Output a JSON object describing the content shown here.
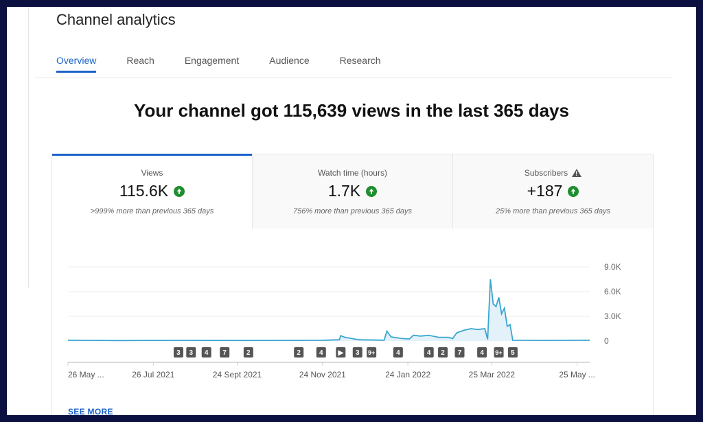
{
  "header": {
    "title": "Channel analytics"
  },
  "tabs": [
    {
      "label": "Overview",
      "active": true
    },
    {
      "label": "Reach"
    },
    {
      "label": "Engagement"
    },
    {
      "label": "Audience"
    },
    {
      "label": "Research"
    }
  ],
  "headline": "Your channel got 115,639 views in the last 365 days",
  "cards": [
    {
      "label": "Views",
      "value": "115.6K",
      "trend": "up",
      "comparison": ">999% more than previous 365 days"
    },
    {
      "label": "Watch time (hours)",
      "value": "1.7K",
      "trend": "up",
      "comparison": "756% more than previous 365 days"
    },
    {
      "label": "Subscribers",
      "value": "+187",
      "trend": "up",
      "warning": true,
      "comparison": "25% more than previous 365 days"
    }
  ],
  "see_more": "SEE MORE",
  "colors": {
    "accent": "#1a62c9",
    "line": "#3aa5cf",
    "fill": "#e3f2fa",
    "up": "#1e8e2e",
    "frame": "#0b1040"
  },
  "chart_data": {
    "type": "area",
    "xlim": [
      "2021-05-26",
      "2022-06-03"
    ],
    "ylim": [
      0,
      9000
    ],
    "y_ticks": [
      "9.0K",
      "6.0K",
      "3.0K",
      "0"
    ],
    "y_tick_values": [
      9000,
      6000,
      3000,
      0
    ],
    "x_tick_labels": [
      "26 May ...",
      "26 Jul 2021",
      "24 Sept 2021",
      "24 Nov 2021",
      "24 Jan 2022",
      "25 Mar 2022",
      "25 May ..."
    ],
    "x_tick_dates": [
      "2021-05-26",
      "2021-07-26",
      "2021-09-24",
      "2021-11-24",
      "2022-01-24",
      "2022-03-25",
      "2022-05-25"
    ],
    "grid": true,
    "points": [
      [
        "2021-05-26",
        100
      ],
      [
        "2021-06-10",
        80
      ],
      [
        "2021-07-01",
        60
      ],
      [
        "2021-08-15",
        80
      ],
      [
        "2021-10-01",
        70
      ],
      [
        "2021-11-25",
        100
      ],
      [
        "2021-12-06",
        150
      ],
      [
        "2021-12-07",
        650
      ],
      [
        "2021-12-10",
        450
      ],
      [
        "2021-12-15",
        300
      ],
      [
        "2021-12-20",
        150
      ],
      [
        "2022-01-07",
        100
      ],
      [
        "2022-01-09",
        1200
      ],
      [
        "2022-01-12",
        500
      ],
      [
        "2022-01-20",
        300
      ],
      [
        "2022-01-25",
        250
      ],
      [
        "2022-01-28",
        700
      ],
      [
        "2022-02-02",
        600
      ],
      [
        "2022-02-08",
        700
      ],
      [
        "2022-02-15",
        450
      ],
      [
        "2022-02-22",
        450
      ],
      [
        "2022-02-25",
        300
      ],
      [
        "2022-02-28",
        1000
      ],
      [
        "2022-03-05",
        1300
      ],
      [
        "2022-03-10",
        1500
      ],
      [
        "2022-03-15",
        1400
      ],
      [
        "2022-03-20",
        1500
      ],
      [
        "2022-03-22",
        200
      ],
      [
        "2022-03-24",
        7500
      ],
      [
        "2022-03-26",
        4500
      ],
      [
        "2022-03-28",
        4200
      ],
      [
        "2022-03-30",
        5300
      ],
      [
        "2022-04-01",
        3300
      ],
      [
        "2022-04-03",
        4000
      ],
      [
        "2022-04-05",
        1800
      ],
      [
        "2022-04-07",
        2000
      ],
      [
        "2022-04-09",
        100
      ],
      [
        "2022-05-01",
        80
      ],
      [
        "2022-06-03",
        100
      ]
    ],
    "markers": [
      [
        "2021-08-13",
        "3"
      ],
      [
        "2021-08-22",
        "3"
      ],
      [
        "2021-09-02",
        "4"
      ],
      [
        "2021-09-15",
        "7"
      ],
      [
        "2021-10-02",
        "2"
      ],
      [
        "2021-11-07",
        "2"
      ],
      [
        "2021-11-23",
        "4"
      ],
      [
        "2021-12-07",
        "▶"
      ],
      [
        "2021-12-19",
        "3"
      ],
      [
        "2021-12-29",
        "9+"
      ],
      [
        "2022-01-17",
        "4"
      ],
      [
        "2022-02-08",
        "4"
      ],
      [
        "2022-02-18",
        "2"
      ],
      [
        "2022-03-02",
        "7"
      ],
      [
        "2022-03-18",
        "4"
      ],
      [
        "2022-03-30",
        "9+"
      ],
      [
        "2022-04-09",
        "5"
      ]
    ]
  }
}
